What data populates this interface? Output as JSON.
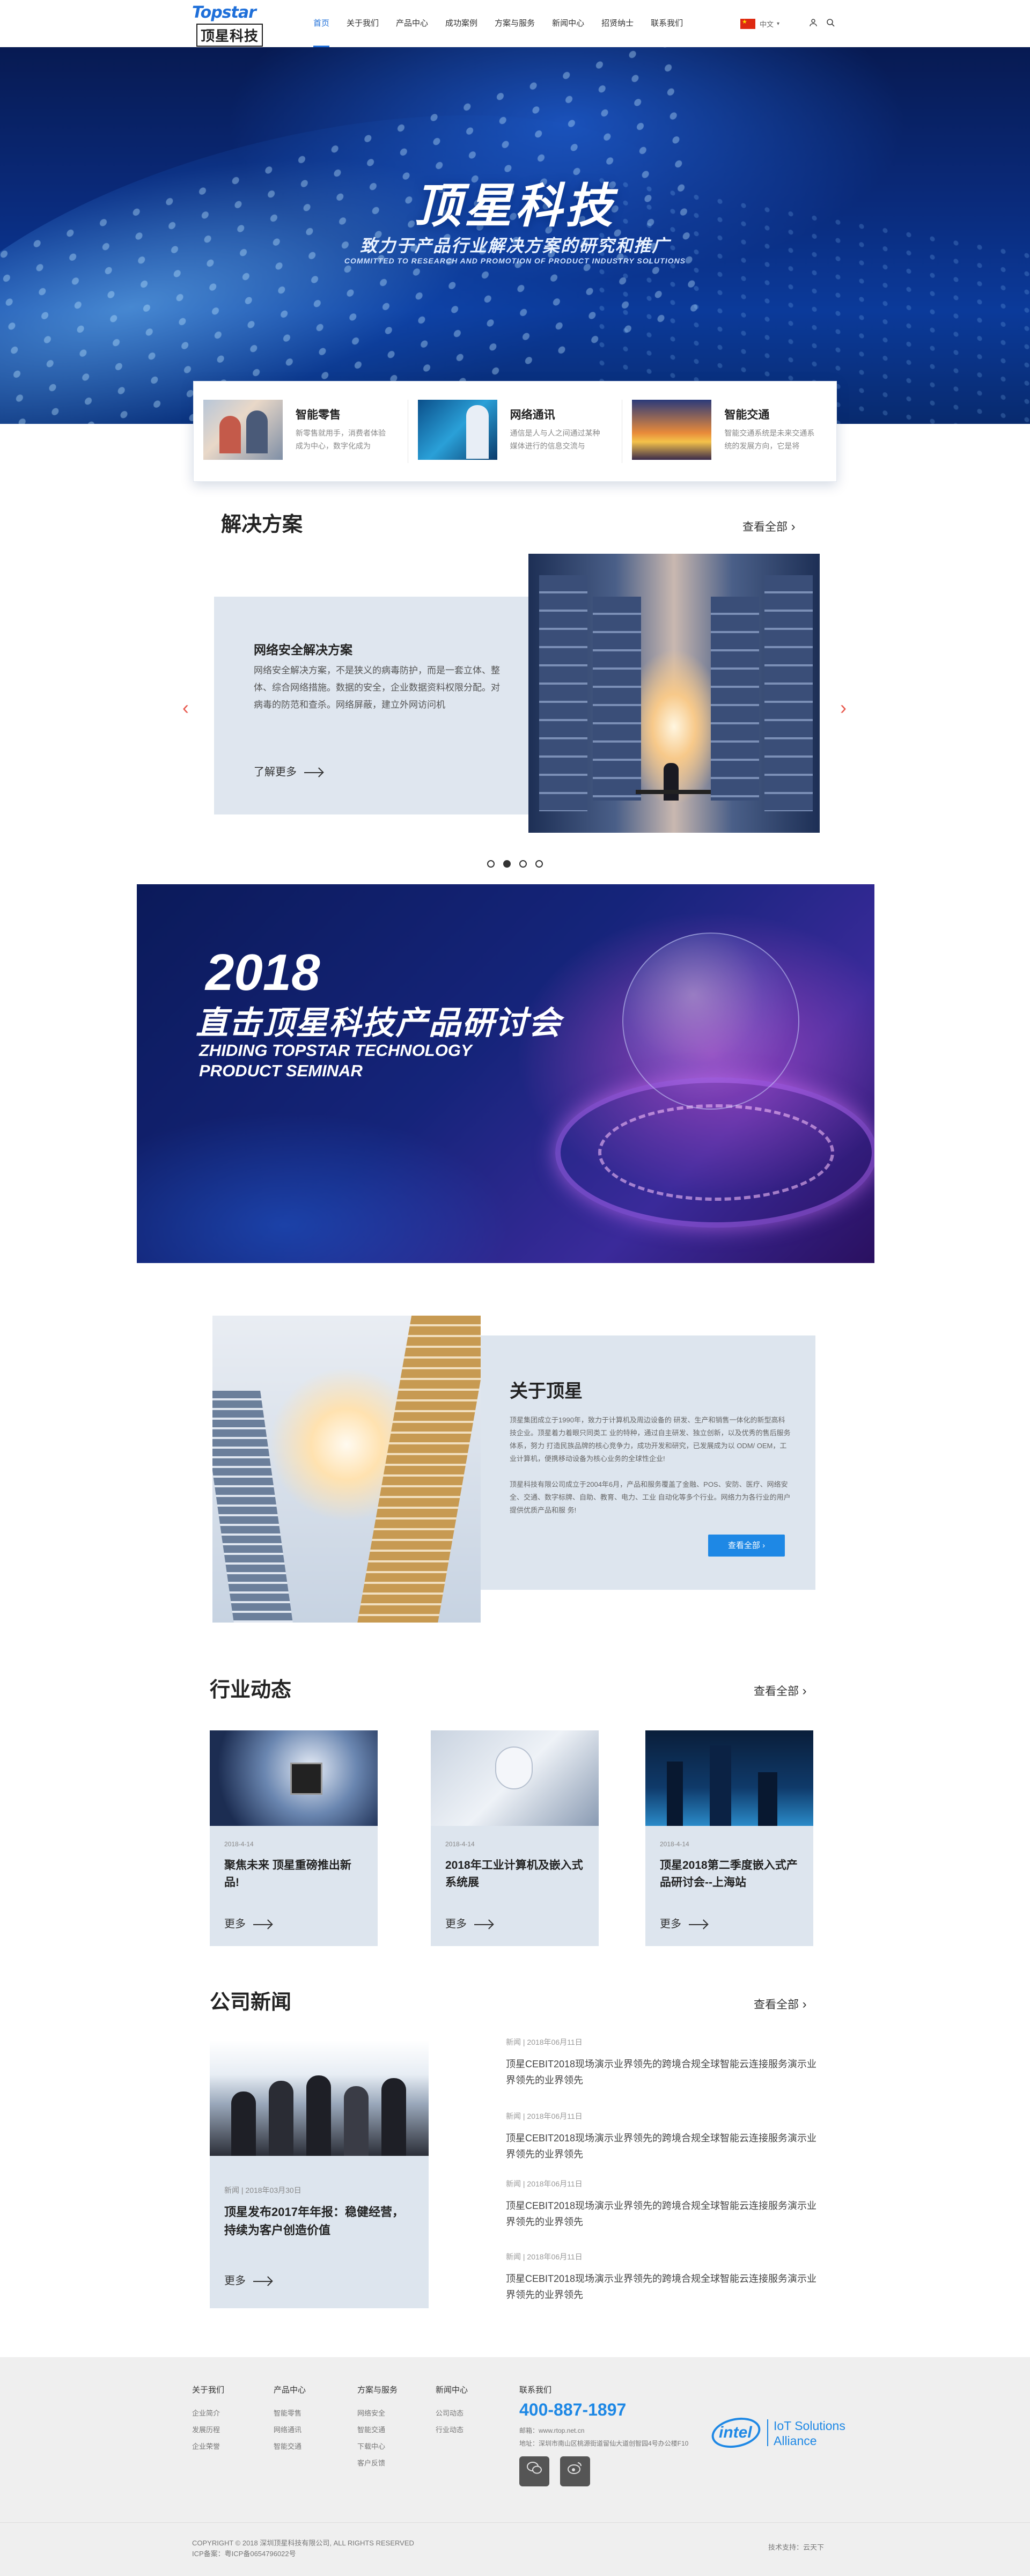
{
  "header": {
    "logo_en": "Topstar",
    "logo_cn": "顶星科技",
    "nav": [
      "首页",
      "关于我们",
      "产品中心",
      "成功案例",
      "方案与服务",
      "新闻中心",
      "招贤纳士",
      "联系我们"
    ],
    "lang": "中文"
  },
  "hero": {
    "title": "顶星科技",
    "subtitle": "致力于产品行业解决方案的研究和推广",
    "subtitle_en": "COMMITTED TO RESEARCH AND PROMOTION OF PRODUCT INDUSTRY SOLUTIONS"
  },
  "features": [
    {
      "title": "智能零售",
      "desc": "新零售就用手，消费者体验成为中心，数字化成为"
    },
    {
      "title": "网络通讯",
      "desc": "通信是人与人之间通过某种媒体进行的信息交流与"
    },
    {
      "title": "智能交通",
      "desc": "智能交通系统是未来交通系统的发展方向，它是将"
    }
  ],
  "solutions": {
    "title": "解决方案",
    "more": "查看全部",
    "item_title": "网络安全解决方案",
    "item_desc": "网络安全解决方案，不是狭义的病毒防护，而是一套立体、整体、综合网络措施。数据的安全，企业数据资料权限分配。对病毒的防范和查杀。网络屏蔽，建立外网访问机",
    "item_more": "了解更多",
    "prev": "‹",
    "next": "›"
  },
  "seminar": {
    "year": "2018",
    "title": "直击顶星科技产品研讨会",
    "en_line1": "ZHIDING TOPSTAR TECHNOLOGY",
    "en_line2": "PRODUCT SEMINAR"
  },
  "about": {
    "title": "关于顶星",
    "p1": "顶星集团成立于1990年，致力于计算机及周边设备的 研发、生产和销售一体化的新型高科技企业。顶星着力着眼只同类工 业的特种，通过自主研发、独立创新，以及优秀的售后服务体系，努力 打造民族品牌的核心竞争力，成功开发和研究，已发展成为以 ODM/ OEM，工业计算机，便携移动设备为核心业务的全球性企业!",
    "p2": "顶星科技有限公司成立于2004年6月，产品和服务覆盖了金融、POS、安防、医疗、网络安全、交通、数字标牌、自助、教育、电力、工业 自动化等多个行业。网络力为各行业的用户提供优质产品和服 务!",
    "button": "查看全部"
  },
  "industry": {
    "title": "行业动态",
    "more": "查看全部",
    "cards": [
      {
        "date": "2018-4-14",
        "title": "聚焦未来 顶星重磅推出新品!",
        "more": "更多"
      },
      {
        "date": "2018-4-14",
        "title": "2018年工业计算机及嵌入式系统展",
        "more": "更多"
      },
      {
        "date": "2018-4-14",
        "title": "顶星2018第二季度嵌入式产品研讨会--上海站",
        "more": "更多"
      }
    ]
  },
  "company_news": {
    "title": "公司新闻",
    "more": "查看全部",
    "featured": {
      "date": "新闻 | 2018年03月30日",
      "title": "顶星发布2017年年报：稳健经营，持续为客户创造价值",
      "more": "更多"
    },
    "items": [
      {
        "date": "新闻 | 2018年06月11日",
        "title": "顶星CEBIT2018现场演示业界领先的跨境合规全球智能云连接服务演示业界领先的业界领先"
      },
      {
        "date": "新闻 | 2018年06月11日",
        "title": "顶星CEBIT2018现场演示业界领先的跨境合规全球智能云连接服务演示业界领先的业界领先"
      },
      {
        "date": "新闻 | 2018年06月11日",
        "title": "顶星CEBIT2018现场演示业界领先的跨境合规全球智能云连接服务演示业界领先的业界领先"
      },
      {
        "date": "新闻 | 2018年06月11日",
        "title": "顶星CEBIT2018现场演示业界领先的跨境合规全球智能云连接服务演示业界领先的业界领先"
      }
    ]
  },
  "footer": {
    "cols": [
      {
        "title": "关于我们",
        "items": [
          "企业简介",
          "发展历程",
          "企业荣誉"
        ]
      },
      {
        "title": "产品中心",
        "items": [
          "智能零售",
          "网络通讯",
          "智能交通"
        ]
      },
      {
        "title": "方案与服务",
        "items": [
          "网络安全",
          "智能交通",
          "下载中心",
          "客户反馈"
        ]
      },
      {
        "title": "新闻中心",
        "items": [
          "公司动态",
          "行业动态"
        ]
      }
    ],
    "contact_title": "联系我们",
    "phone": "400-887-1897",
    "email": "邮箱：www.rtop.net.cn",
    "address": "地址：深圳市南山区桃源街道留仙大道创智园4号办公楼F10",
    "intel_logo": "intel",
    "intel_tag_1": "IoT Solutions",
    "intel_tag_2": "Alliance",
    "copyright": "COPYRIGHT © 2018 深圳顶星科技有限公司, ALL RIGHTS RESERVED",
    "icp": "ICP备案：粤ICP备0654796022号",
    "tech": "技术支持：云天下"
  }
}
